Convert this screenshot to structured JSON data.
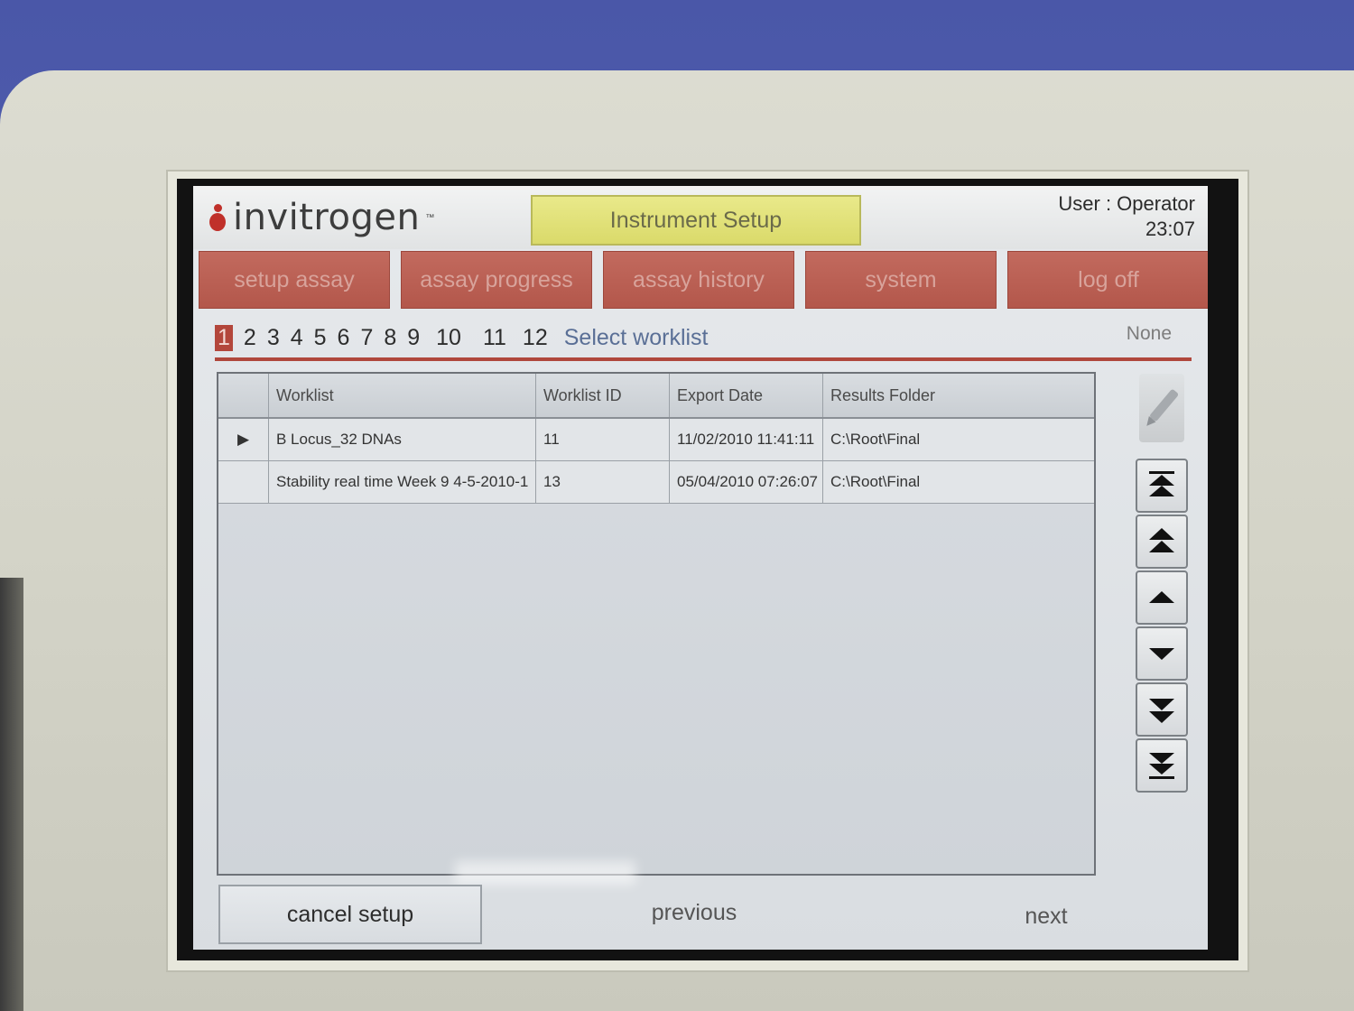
{
  "app": {
    "brand": "invitrogen",
    "brand_tm": "™",
    "screen_title": "Instrument Setup",
    "user": "User : Operator",
    "time": "23:07"
  },
  "nav": {
    "tabs": [
      {
        "label": "setup assay"
      },
      {
        "label": "assay progress"
      },
      {
        "label": "assay history"
      },
      {
        "label": "system"
      },
      {
        "label": "log off"
      }
    ]
  },
  "wizard": {
    "steps": [
      "1",
      "2",
      "3",
      "4",
      "5",
      "6",
      "7",
      "8",
      "9",
      "10",
      "11",
      "12"
    ],
    "active_step": "1",
    "step_label": "Select worklist",
    "status": "None"
  },
  "table": {
    "columns": [
      "Worklist",
      "Worklist ID",
      "Export Date",
      "Results Folder"
    ],
    "rows": [
      {
        "indicator": "▶",
        "worklist": "B Locus_32 DNAs",
        "id": "11",
        "date": "11/02/2010 11:41:11",
        "folder": "C:\\Root\\Final"
      },
      {
        "indicator": "",
        "worklist": "Stability real time Week 9 4-5-2010-1",
        "id": "13",
        "date": "05/04/2010 07:26:07",
        "folder": "C:\\Root\\Final"
      }
    ]
  },
  "footer": {
    "cancel": "cancel setup",
    "previous": "previous",
    "next": "next"
  },
  "colors": {
    "accent_red": "#b3574b",
    "title_yellow": "#dada6a",
    "step_blue": "#5a6f96"
  },
  "icons": {
    "edit": "pencil-icon",
    "scroll": [
      "scroll-top-icon",
      "page-up-icon",
      "line-up-icon",
      "line-down-icon",
      "page-down-icon",
      "scroll-bottom-icon"
    ]
  }
}
